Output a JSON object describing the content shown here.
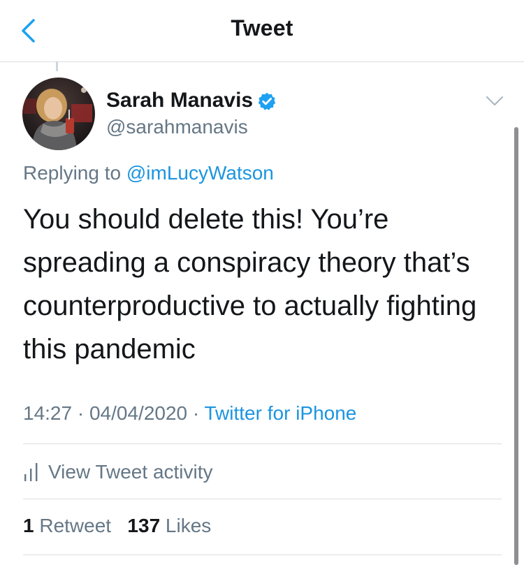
{
  "header": {
    "title": "Tweet"
  },
  "tweet": {
    "author_name": "Sarah Manavis",
    "author_handle": "@sarahmanavis",
    "replying_prefix": "Replying to",
    "replying_to": "@imLucyWatson",
    "text": "You should delete this! You’re spreading a conspiracy theory that’s counterproductive to actually fighting this pandemic",
    "time": "14:27",
    "date": "04/04/2020",
    "source": "Twitter for iPhone",
    "separator": "·"
  },
  "activity": {
    "label": "View Tweet activity"
  },
  "stats": {
    "retweets_count": "1",
    "retweets_label": "Retweet",
    "likes_count": "137",
    "likes_label": "Likes"
  },
  "colors": {
    "accent": "#1b95e0",
    "secondary_text": "#657786",
    "primary_text": "#14171a",
    "divider": "#d9dde0"
  },
  "icons": {
    "back": "chevron-left-icon",
    "verified": "verified-badge-icon",
    "caret": "chevron-down-icon",
    "activity": "bar-chart-icon"
  }
}
